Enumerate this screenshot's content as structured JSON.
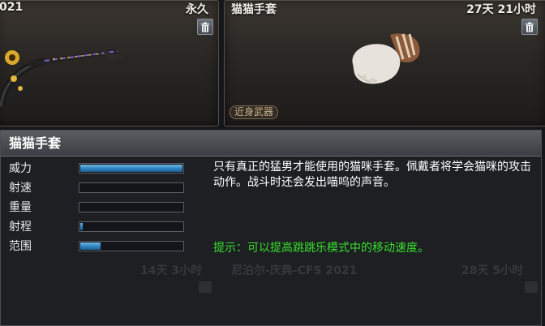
{
  "cards": [
    {
      "name": "021",
      "time": "永久"
    },
    {
      "name": "猫猫手套",
      "time": "27天 21小时",
      "tag": "近身武器"
    }
  ],
  "tooltip": {
    "title": "猫猫手套",
    "stats": [
      {
        "label": "威力",
        "value": 1.0
      },
      {
        "label": "射速",
        "value": 0.0
      },
      {
        "label": "重量",
        "value": 0.0
      },
      {
        "label": "射程",
        "value": 0.02
      },
      {
        "label": "范围",
        "value": 0.2
      }
    ],
    "description": "只有真正的猛男才能使用的猫咪手套。佩戴者将学会猫咪的攻击动作。战斗时还会发出喵呜的声音。",
    "hint": "提示：可以提高跳跳乐模式中的移动速度。"
  },
  "background_row": {
    "left_time": "14天 3小时",
    "name": "尼泊尔-庆典-CFS 2021",
    "right_time": "28天 5小时"
  },
  "colors": {
    "bar_fill": "#2f83bd",
    "hint": "#37e02c"
  },
  "icons": {
    "trash": "trash-icon"
  }
}
